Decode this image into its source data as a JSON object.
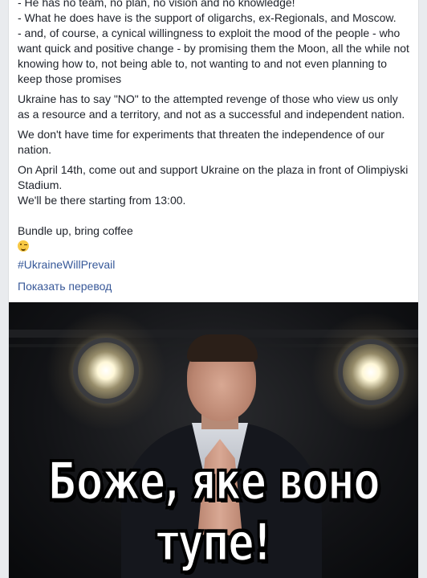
{
  "post": {
    "paragraphs": [
      "- He has no team, no plan, no vision and no knowledge!\n- What he does have is the support of oligarchs, ex-Regionals, and Moscow.\n- and, of course, a cynical willingness to exploit the mood of the people - who want quick and positive change - by promising them the Moon, all the while not knowing how to, not being able to, not wanting to and not even planning to keep those promises",
      "Ukraine has to say \"NO\" to the attempted revenge of those who view us only as a resource and a territory, and not as a successful and independent nation.",
      "We don't have time for experiments that threaten the independence of our nation.",
      "On April 14th, come out and support Ukraine on the plaza in front of Olimpiyski Stadium.\nWe'll be there starting from 13:00."
    ],
    "last_line": "Bundle up, bring coffee",
    "emoji": "wink-emoji",
    "hashtag": "#UkraineWillPrevail",
    "translate_link": "Показать перевод"
  },
  "photo": {
    "caption": "Боже, яке воно тупе!"
  }
}
